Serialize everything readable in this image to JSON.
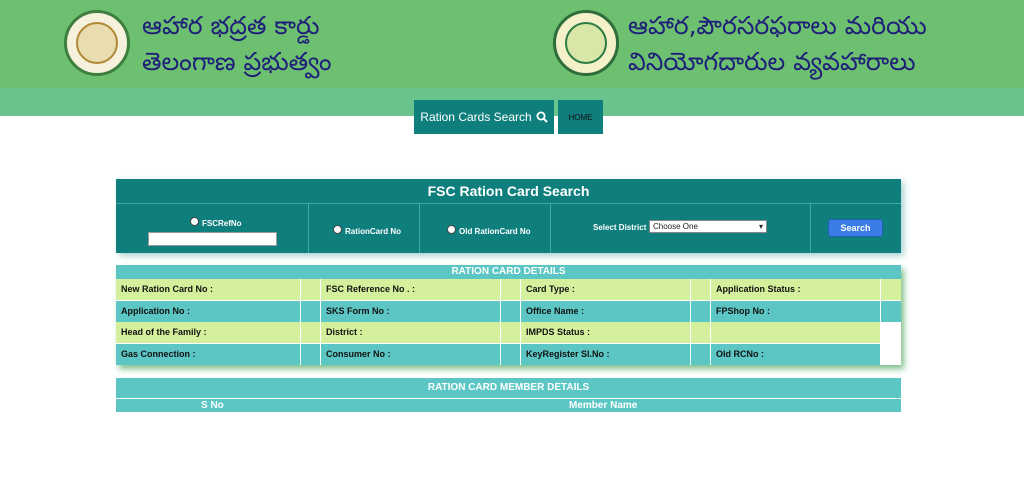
{
  "header": {
    "title_left_line1": "ఆహార భద్రత కార్డు",
    "title_left_line2": "తెలంగాణ ప్రభుత్వం",
    "title_right_line1": "ఆహార,పౌరసరఫరాలు మరియు",
    "title_right_line2": "వినియోగదారుల వ్యవహారాలు",
    "left_emblem_icon": "telangana-emblem-icon",
    "right_emblem_icon": "civil-supplies-logo-icon"
  },
  "nav": {
    "ration_search_label": "Ration Cards Search",
    "home_label": "HOME"
  },
  "search": {
    "title": "FSC Ration Card Search",
    "options": [
      "FSCRefNo",
      "RationCard No",
      "Old RationCard No"
    ],
    "district_label": "Select District :",
    "district_value": "Choose One",
    "search_button": "Search"
  },
  "details": {
    "title": "RATION CARD DETAILS",
    "rows": [
      [
        "New Ration Card No :",
        "FSC Reference No . :",
        "Card Type :",
        "Application Status :"
      ],
      [
        "Application No :",
        "SKS Form No :",
        "Office Name :",
        "FPShop No :"
      ],
      [
        "Head of the Family :",
        "District :",
        "IMPDS Status :",
        ""
      ],
      [
        "Gas Connection :",
        "Consumer No :",
        "KeyRegister Sl.No :",
        "Old RCNo :"
      ]
    ]
  },
  "members": {
    "title": "RATION CARD MEMBER DETAILS",
    "columns": [
      "S No",
      "Member Name"
    ]
  },
  "colors": {
    "banner_green": "#6cc070",
    "teal": "#0f7f7d",
    "light_teal": "#5bc6c4",
    "light_green_row": "#d5f09c",
    "title_blue": "#1f1f7a"
  }
}
